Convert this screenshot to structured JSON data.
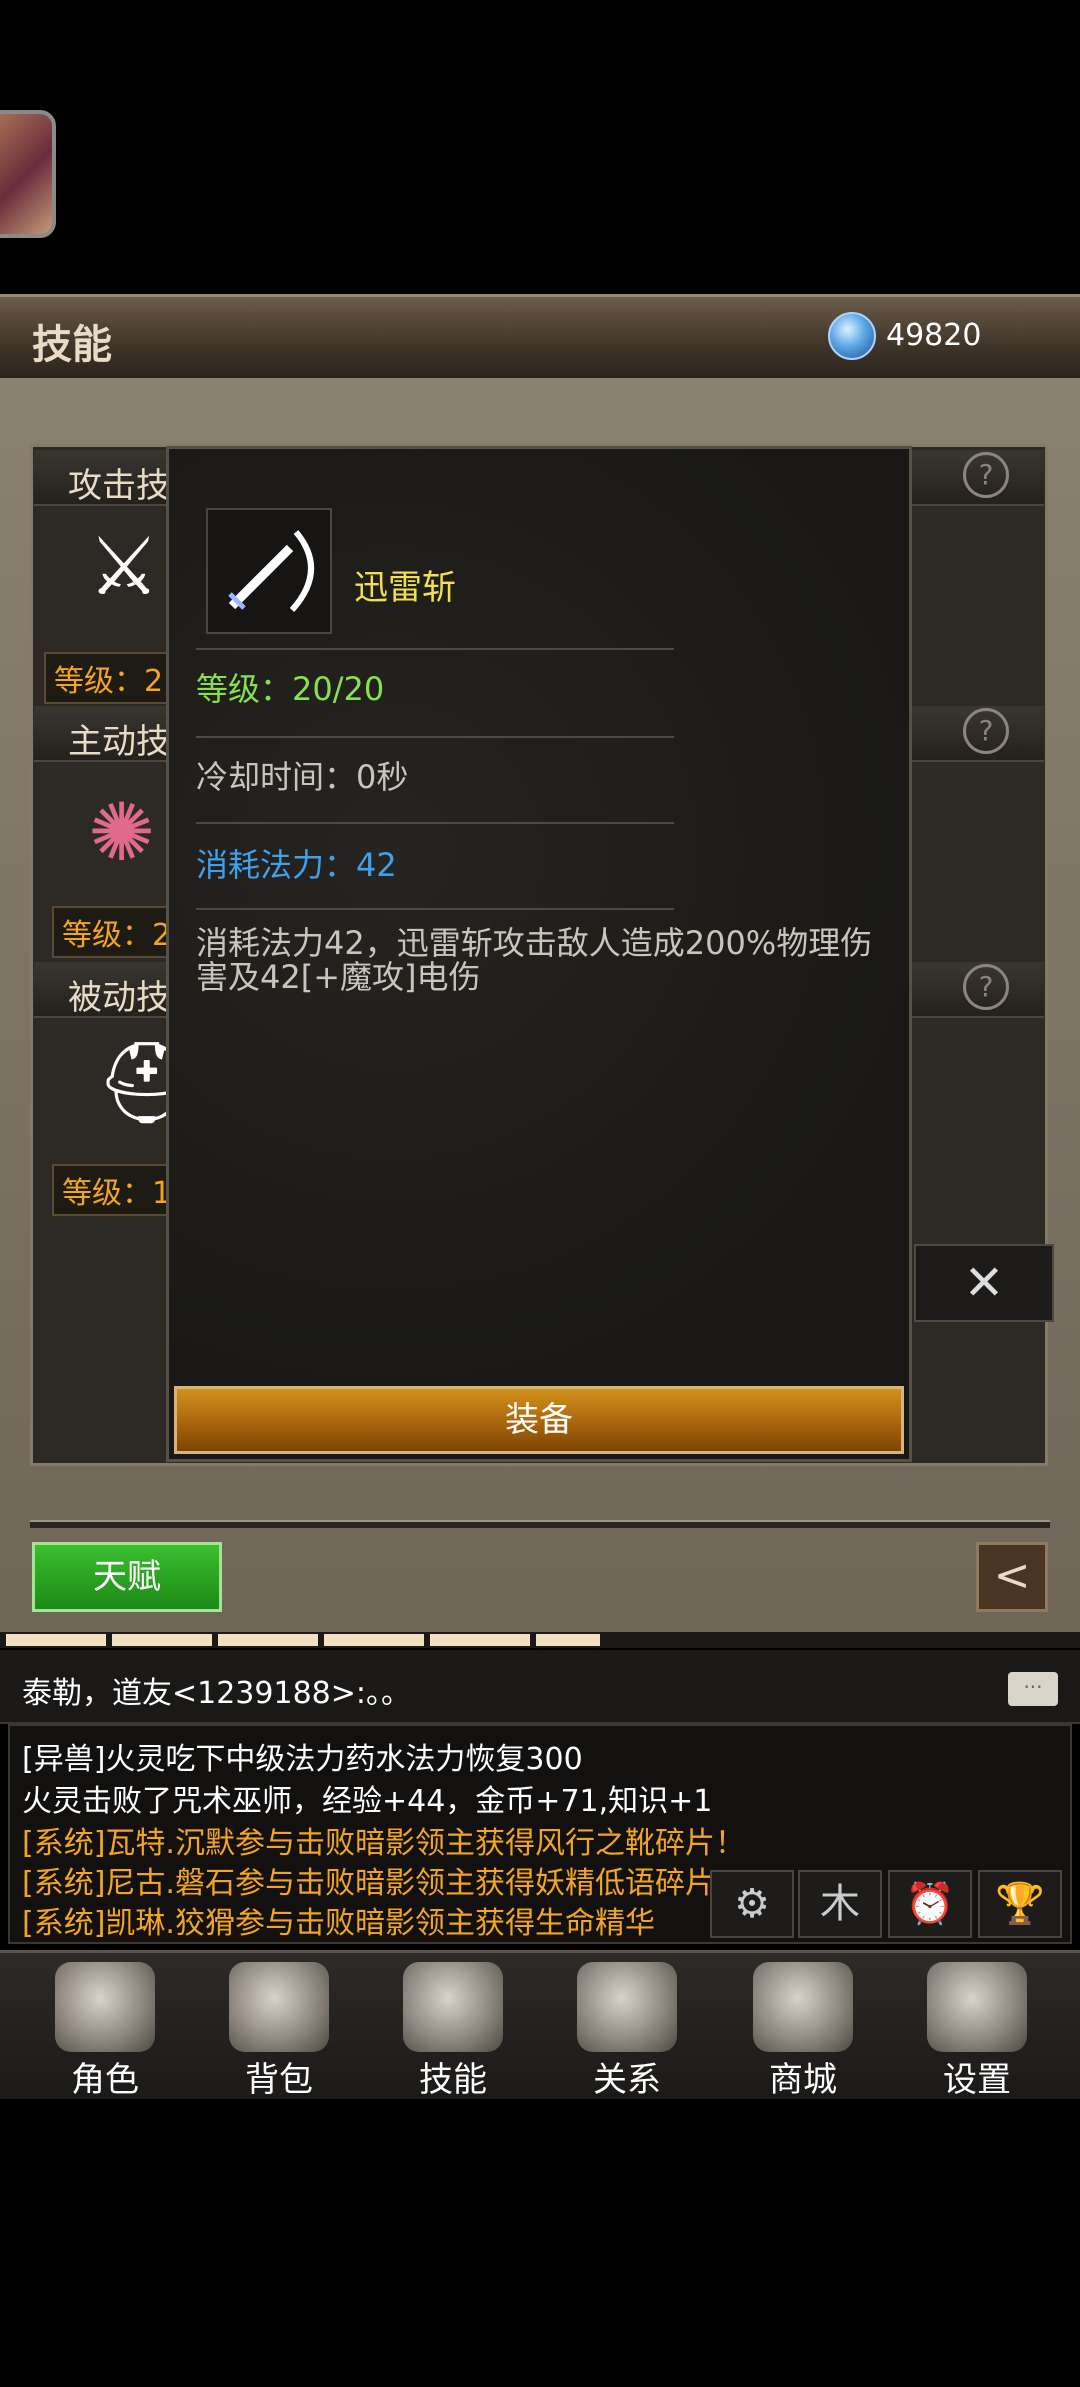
{
  "header": {
    "title": "技能",
    "coins": "49820"
  },
  "sections": [
    {
      "label": "攻击技",
      "level": "等级：2"
    },
    {
      "label": "主动技",
      "level": "等级：2"
    },
    {
      "label": "被动技",
      "level": "等级：1"
    }
  ],
  "popup": {
    "skill_name": "迅雷斩",
    "level": "等级：20/20",
    "cooldown": "冷却时间：0秒",
    "mana_cost": "消耗法力：42",
    "description": "消耗法力42，迅雷斩攻击敌人造成200%物理伤害及42[+魔攻]电伤",
    "equip_label": "装备",
    "close_label": "✕"
  },
  "controls": {
    "talent_label": "天赋",
    "back_label": "<"
  },
  "chat": {
    "input_text": "泰勒，道友<1239188>:。。",
    "lines": [
      {
        "text": "[异兽]火灵吃下中级法力药水法力恢复300",
        "color": "#ffffff"
      },
      {
        "text": "火灵击败了咒术巫师，经验+44，金币+71,知识+1",
        "color": "#ffffff"
      },
      {
        "text": "[系统]瓦特.沉默参与击败暗影领主获得风行之靴碎片！",
        "color": "#f2a522"
      },
      {
        "text": "[系统]尼古.磐石参与击败暗影领主获得妖精低语碎片！",
        "color": "#f2a522"
      },
      {
        "text": "[系统]凯琳.狡猾参与击败暗影领主获得生命精华",
        "color": "#f2a522"
      }
    ]
  },
  "nav": [
    {
      "label": "角色",
      "icon": "helmet-icon"
    },
    {
      "label": "背包",
      "icon": "backpack-icon"
    },
    {
      "label": "技能",
      "icon": "skill-book-icon"
    },
    {
      "label": "关系",
      "icon": "handshake-icon"
    },
    {
      "label": "商城",
      "icon": "chest-icon"
    },
    {
      "label": "设置",
      "icon": "gear-icon"
    }
  ],
  "colors": {
    "gold": "#f2a522",
    "green": "#88e04c",
    "blue": "#3fa0ee",
    "name": "#f0e054"
  }
}
